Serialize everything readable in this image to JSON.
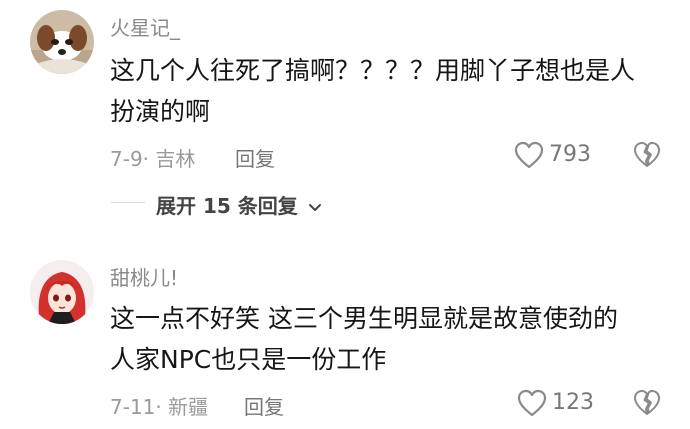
{
  "comments": [
    {
      "username": "火星记_",
      "text_line1": "这几个人往死了搞啊？？？？用脚丫子想也是人",
      "text_line2": "扮演的啊",
      "meta": "7-9· 吉林",
      "reply_label": "回复",
      "likes": "793",
      "avatar_icon": "dog-avatar"
    },
    {
      "username": "甜桃儿!",
      "text_line1": "这一点不好笑 这三个男生明显就是故意使劲的",
      "text_line2": "人家NPC也只是一份工作",
      "meta": "7-11· 新疆",
      "reply_label": "回复",
      "likes": "123",
      "avatar_icon": "anime-girl-avatar"
    }
  ],
  "expand_replies": {
    "label": "展开 15 条回复",
    "icon": "chevron-down-icon"
  }
}
